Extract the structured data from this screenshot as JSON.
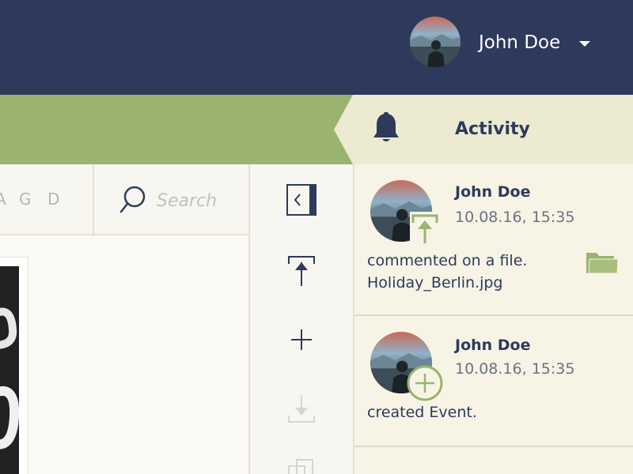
{
  "header": {
    "user_name": "John Doe",
    "colors": {
      "background": "#2e3a5c",
      "text": "#ffffff"
    }
  },
  "activity_panel": {
    "title": "Activity",
    "colors": {
      "accent_green": "#9ab371",
      "header_bg": "#ecead0",
      "navy": "#2e3a5c"
    }
  },
  "filter": {
    "letters": [
      "A",
      "G",
      "D"
    ]
  },
  "search": {
    "placeholder": "Search"
  },
  "toolbar": {
    "tools": [
      "collapse-panel-icon",
      "upload-icon",
      "add-icon",
      "download-icon",
      "copy-icon"
    ]
  },
  "activities": [
    {
      "user": "John Doe",
      "timestamp": "10.08.16, 15:35",
      "action": "commented on a file.",
      "file": "Holiday_Berlin.jpg",
      "badge_icon": "upload-icon"
    },
    {
      "user": "John Doe",
      "timestamp": "10.08.16, 15:35",
      "action": "created Event.",
      "badge_icon": "add-circle-icon"
    }
  ]
}
